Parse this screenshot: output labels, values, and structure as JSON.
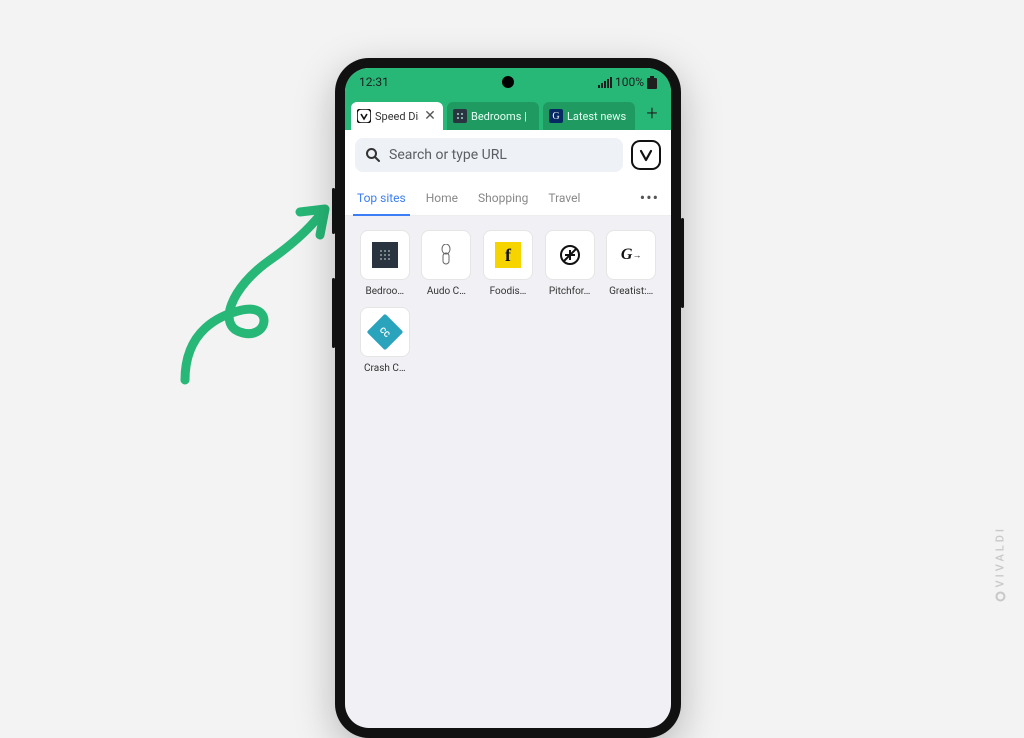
{
  "watermark": "VIVALDI",
  "status": {
    "time": "12:31",
    "battery": "100%"
  },
  "tabs": [
    {
      "label": "Speed Dial",
      "active": true,
      "icon": "vivaldi"
    },
    {
      "label": "Bedrooms |",
      "active": false,
      "icon": "grid"
    },
    {
      "label": "Latest news",
      "active": false,
      "icon": "guardian"
    }
  ],
  "addressbar": {
    "placeholder": "Search or type URL"
  },
  "categories": [
    "Top sites",
    "Home",
    "Shopping",
    "Travel"
  ],
  "active_category": 0,
  "speed_dials": [
    {
      "label": "Bedroo…"
    },
    {
      "label": "Audo C…"
    },
    {
      "label": "Foodis…"
    },
    {
      "label": "Pitchfor…"
    },
    {
      "label": "Greatist:…"
    },
    {
      "label": "Crash C…"
    }
  ]
}
